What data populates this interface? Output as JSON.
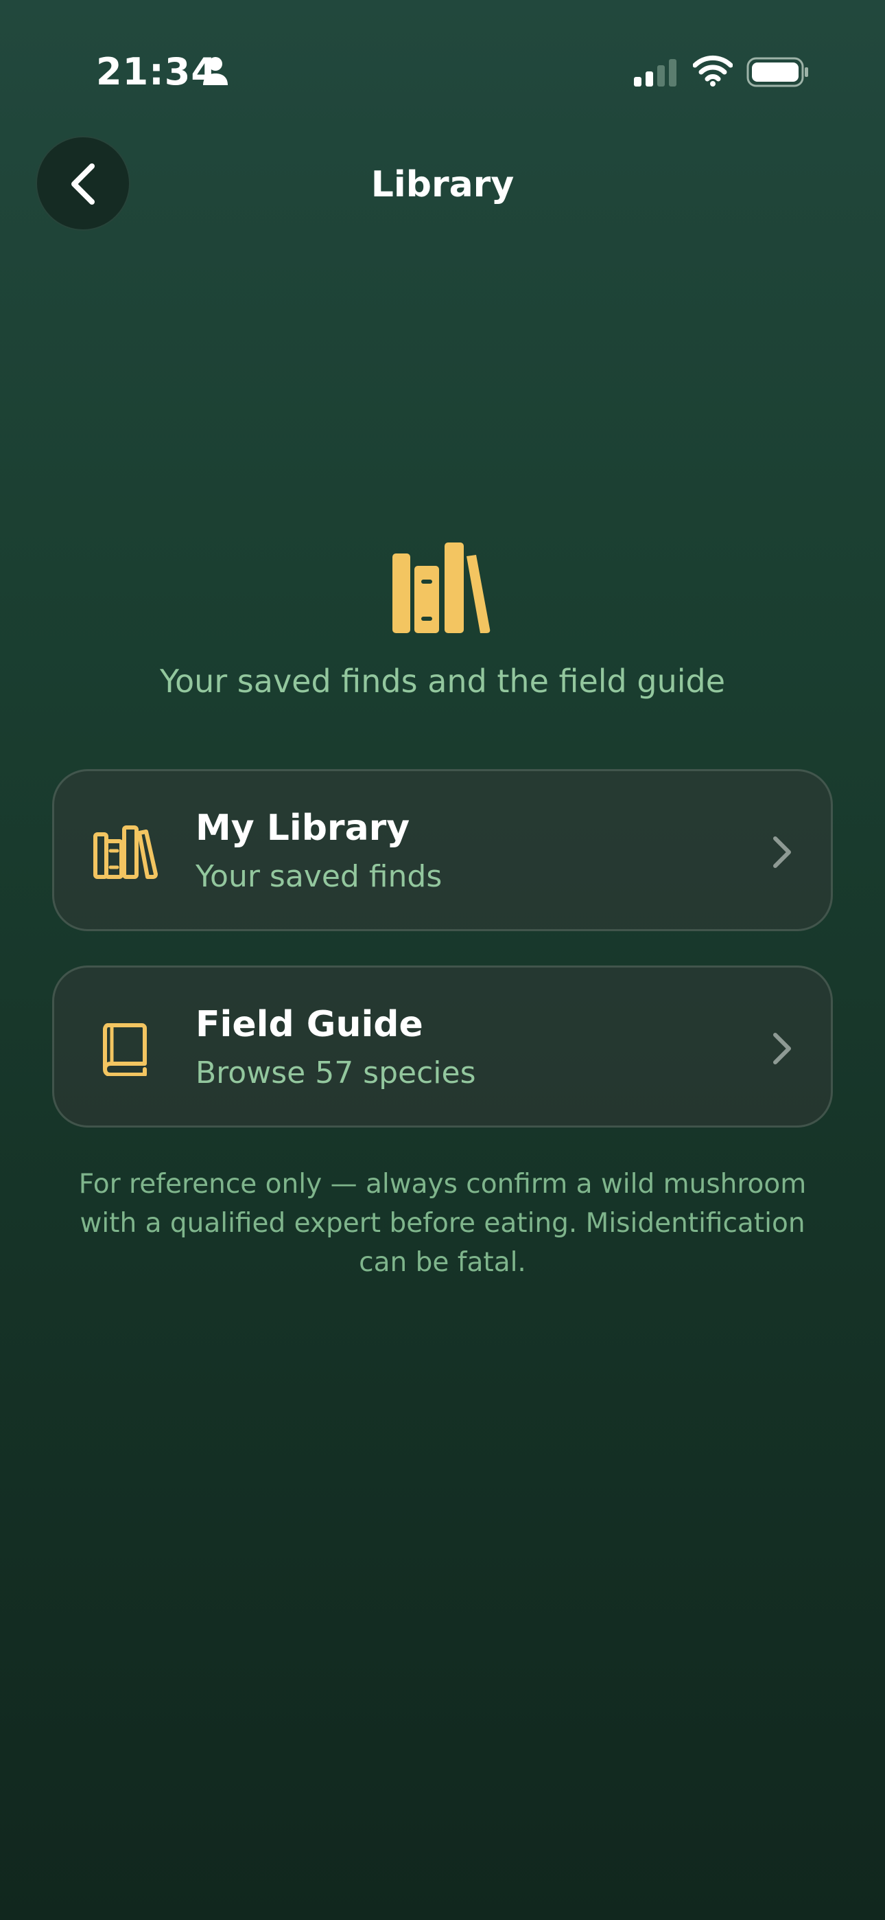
{
  "status_bar": {
    "time": "21:34",
    "icons": [
      "person-icon",
      "signal-icon",
      "wifi-icon",
      "battery-icon"
    ]
  },
  "header": {
    "title": "Library",
    "back_icon": "chevron-left-icon"
  },
  "hero": {
    "icon": "books-icon",
    "subtitle": "Your saved finds and the field guide"
  },
  "cards": [
    {
      "icon": "books-icon",
      "title": "My Library",
      "subtitle": "Your saved finds"
    },
    {
      "icon": "book-icon",
      "title": "Field Guide",
      "subtitle": "Browse 57 species"
    }
  ],
  "disclaimer": "For reference only — always confirm a wild mushroom with a qualified expert before eating. Misidentification can be fatal.",
  "colors": {
    "accent": "#f3c561",
    "secondary_text": "#93c79e",
    "background_top": "#22483d",
    "background_bottom": "#11271e"
  }
}
